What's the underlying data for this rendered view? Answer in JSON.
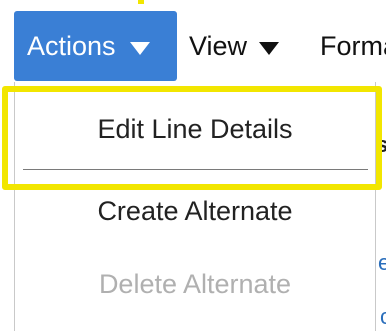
{
  "toolbar": {
    "actions_label": "Actions",
    "view_label": "View",
    "format_label": "Format"
  },
  "dropdown": {
    "items": [
      {
        "label": "Edit Line Details",
        "enabled": true
      },
      {
        "label": "Create Alternate",
        "enabled": true
      },
      {
        "label": "Delete Alternate",
        "enabled": false
      }
    ]
  },
  "background_fragments": {
    "s": "s",
    "e": "e",
    "c": "c"
  },
  "colors": {
    "actions_button": "#3a7fd5",
    "highlight": "#f2e600",
    "disabled_text": "#b0b0b0"
  },
  "icons": {
    "actions_caret": "caret-down-icon",
    "view_caret": "caret-down-icon"
  }
}
